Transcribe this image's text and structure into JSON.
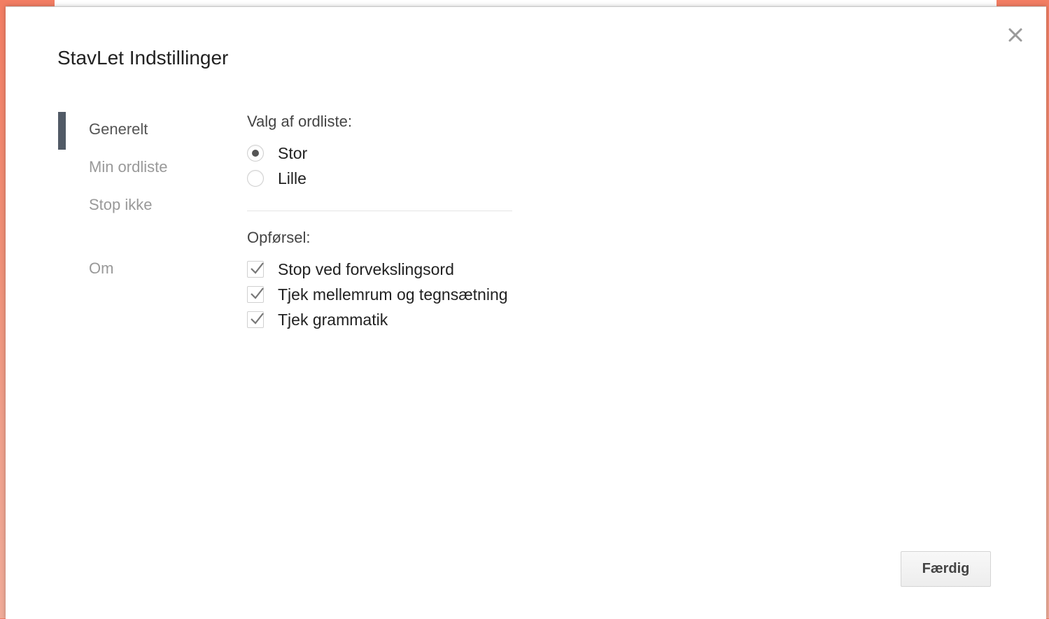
{
  "dialog": {
    "title": "StavLet Indstillinger",
    "close_icon": "close-icon"
  },
  "nav": {
    "items": [
      {
        "label": "Generelt",
        "active": true
      },
      {
        "label": "Min ordliste",
        "active": false
      },
      {
        "label": "Stop ikke",
        "active": false
      },
      {
        "label": "Om",
        "active": false
      }
    ]
  },
  "dictionary": {
    "heading": "Valg af ordliste:",
    "options": [
      {
        "label": "Stor",
        "selected": true
      },
      {
        "label": "Lille",
        "selected": false
      }
    ]
  },
  "behavior": {
    "heading": "Opførsel:",
    "options": [
      {
        "label": "Stop ved forvekslingsord",
        "checked": true
      },
      {
        "label": "Tjek mellemrum og tegnsætning",
        "checked": true
      },
      {
        "label": "Tjek grammatik",
        "checked": true
      }
    ]
  },
  "footer": {
    "done_label": "Færdig"
  },
  "colors": {
    "background": "#f27d63",
    "nav_indicator": "#515a66",
    "inactive_nav_text": "#999999"
  }
}
